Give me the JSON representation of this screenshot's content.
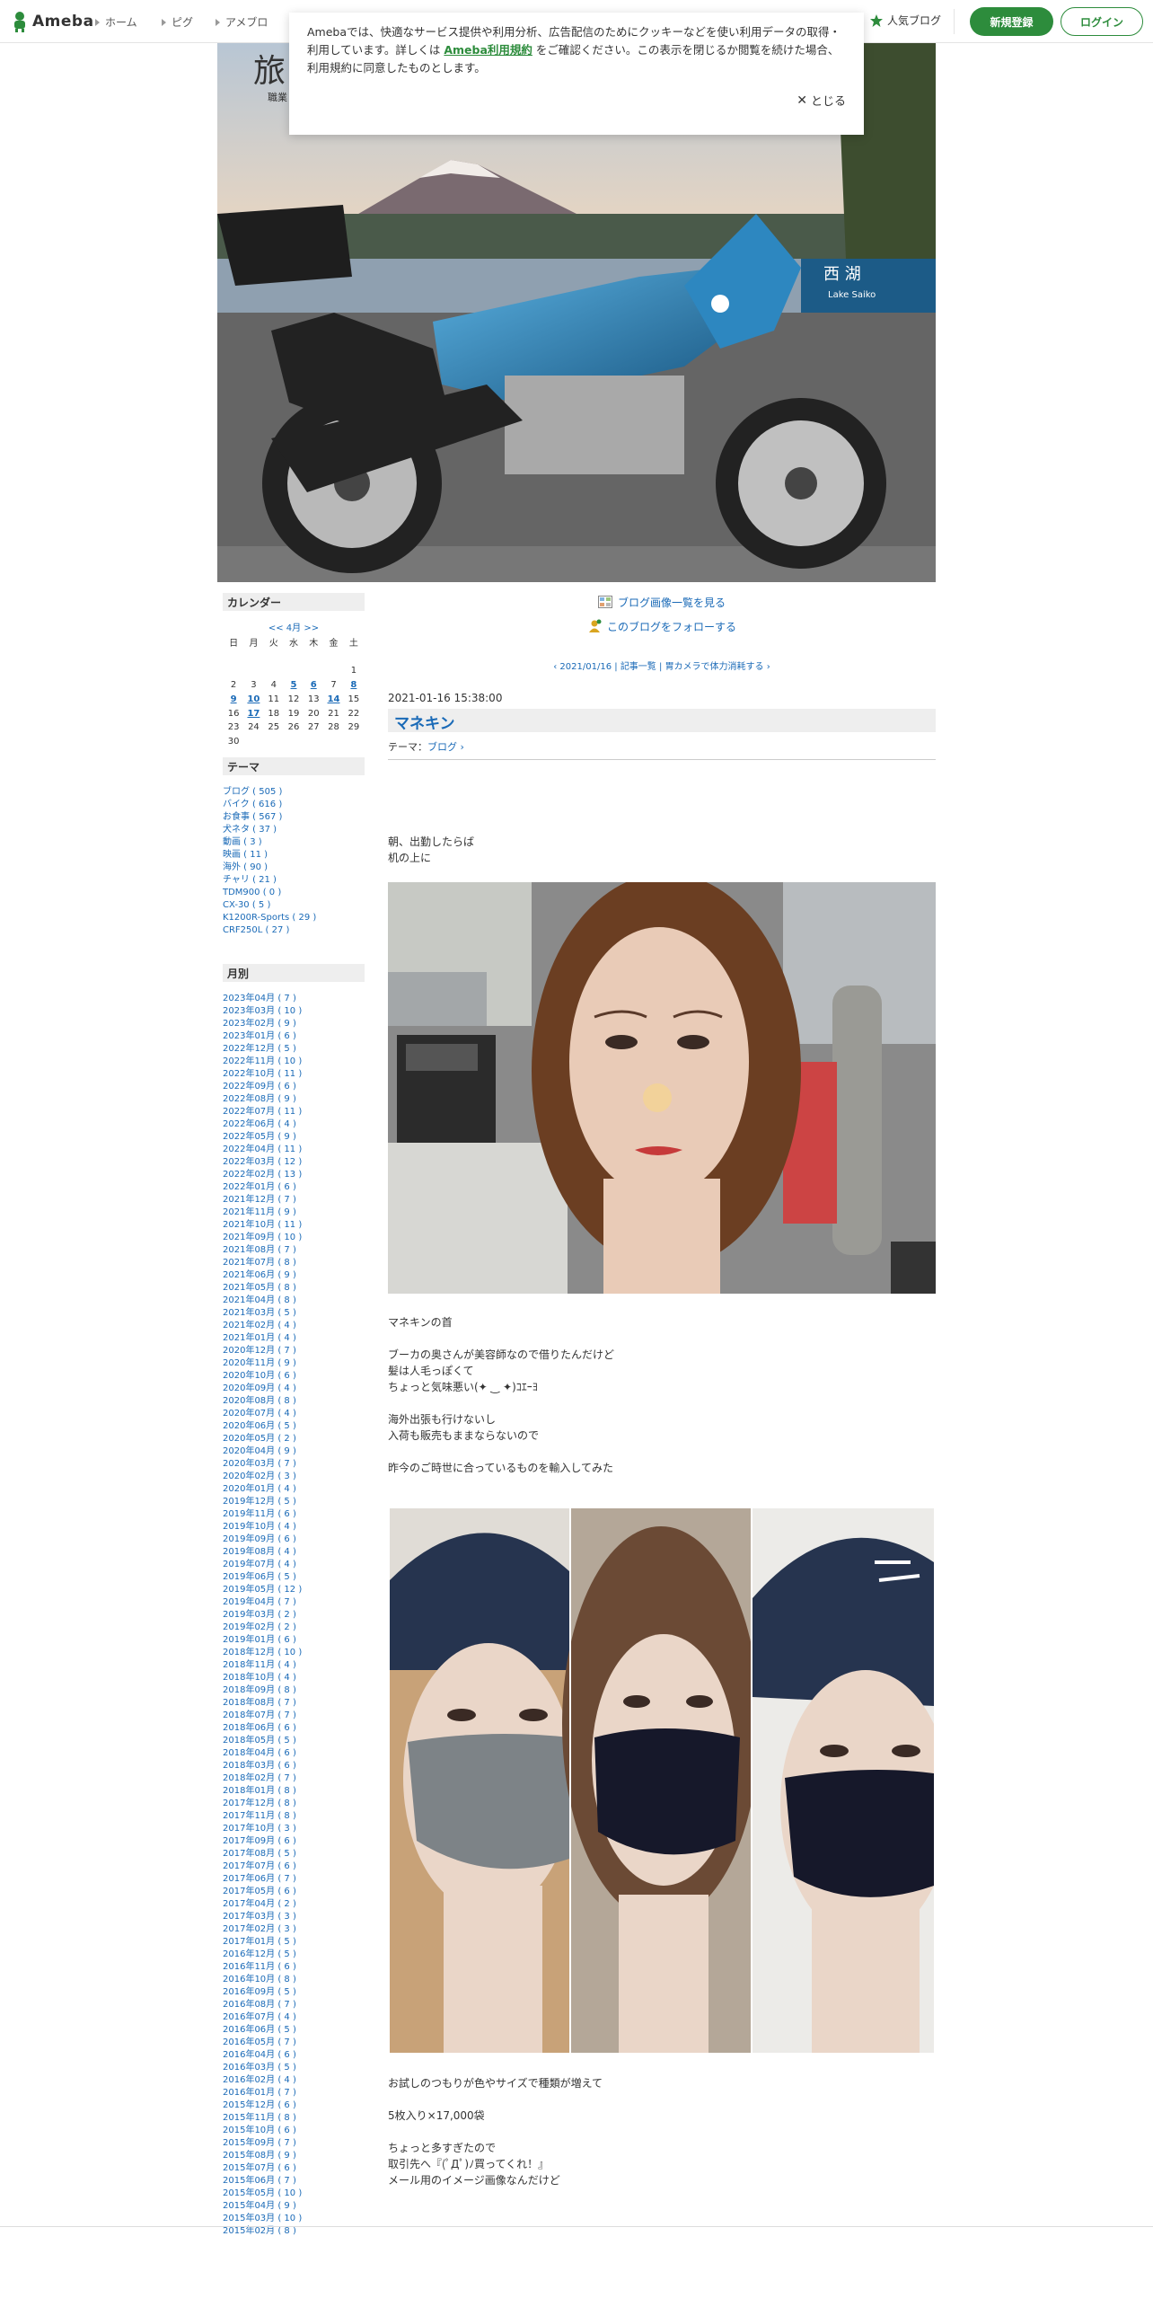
{
  "topbar": {
    "logo_text": "Ameba",
    "nav": [
      "ホーム",
      "ピグ",
      "アメブロ"
    ],
    "popular": "人気ブログ",
    "register": "新規登録",
    "login": "ログイン"
  },
  "cookie": {
    "text_before": "Amebaでは、快適なサービス提供や利用分析、広告配信のためにクッキーなどを使い利用データの取得・利用しています。詳しくは ",
    "link": "Ameba利用規約",
    "text_after": " をご確認ください。この表示を閉じるか閲覧を続けた場合、利用規約に同意したものとします。",
    "close": "とじる"
  },
  "blog": {
    "title": "旅",
    "subtitle": "職業"
  },
  "calendar": {
    "heading": "カレンダー",
    "nav": "<< 4月 >>",
    "weekdays": [
      "日",
      "月",
      "火",
      "水",
      "木",
      "金",
      "土"
    ],
    "weeks": [
      [
        "",
        "",
        "",
        "",
        "",
        "",
        "1"
      ],
      [
        "2",
        "3",
        "4",
        "5",
        "6",
        "7",
        "8"
      ],
      [
        "9",
        "10",
        "11",
        "12",
        "13",
        "14",
        "15"
      ],
      [
        "16",
        "17",
        "18",
        "19",
        "20",
        "21",
        "22"
      ],
      [
        "23",
        "24",
        "25",
        "26",
        "27",
        "28",
        "29"
      ],
      [
        "30",
        "",
        "",
        "",
        "",
        "",
        ""
      ]
    ]
  },
  "theme_box": {
    "heading": "テーマ",
    "items": [
      "ブログ ( 505 )",
      "バイク ( 616 )",
      "お食事 ( 567 )",
      "犬ネタ ( 37 )",
      "動画 ( 3 )",
      "映画 ( 11 )",
      "海外 ( 90 )",
      "チャリ ( 21 )",
      "TDM900 ( 0 )",
      "CX-30 ( 5 )",
      "K1200R-Sports ( 29 )",
      "CRF250L ( 27 )"
    ]
  },
  "monthly": {
    "heading": "月別",
    "items": [
      "2023年04月 ( 7 )",
      "2023年03月 ( 10 )",
      "2023年02月 ( 9 )",
      "2023年01月 ( 6 )",
      "2022年12月 ( 5 )",
      "2022年11月 ( 10 )",
      "2022年10月 ( 11 )",
      "2022年09月 ( 6 )",
      "2022年08月 ( 9 )",
      "2022年07月 ( 11 )",
      "2022年06月 ( 4 )",
      "2022年05月 ( 9 )",
      "2022年04月 ( 11 )",
      "2022年03月 ( 12 )",
      "2022年02月 ( 13 )",
      "2022年01月 ( 6 )",
      "2021年12月 ( 7 )",
      "2021年11月 ( 9 )",
      "2021年10月 ( 11 )",
      "2021年09月 ( 10 )",
      "2021年08月 ( 7 )",
      "2021年07月 ( 8 )",
      "2021年06月 ( 9 )",
      "2021年05月 ( 8 )",
      "2021年04月 ( 8 )",
      "2021年03月 ( 5 )",
      "2021年02月 ( 4 )",
      "2021年01月 ( 4 )",
      "2020年12月 ( 7 )",
      "2020年11月 ( 9 )",
      "2020年10月 ( 6 )",
      "2020年09月 ( 4 )",
      "2020年08月 ( 8 )",
      "2020年07月 ( 4 )",
      "2020年06月 ( 5 )",
      "2020年05月 ( 2 )",
      "2020年04月 ( 9 )",
      "2020年03月 ( 7 )",
      "2020年02月 ( 3 )",
      "2020年01月 ( 4 )",
      "2019年12月 ( 5 )",
      "2019年11月 ( 6 )",
      "2019年10月 ( 4 )",
      "2019年09月 ( 6 )",
      "2019年08月 ( 4 )",
      "2019年07月 ( 4 )",
      "2019年06月 ( 5 )",
      "2019年05月 ( 12 )",
      "2019年04月 ( 7 )",
      "2019年03月 ( 2 )",
      "2019年02月 ( 2 )",
      "2019年01月 ( 6 )",
      "2018年12月 ( 10 )",
      "2018年11月 ( 4 )",
      "2018年10月 ( 4 )",
      "2018年09月 ( 8 )",
      "2018年08月 ( 7 )",
      "2018年07月 ( 7 )",
      "2018年06月 ( 6 )",
      "2018年05月 ( 5 )",
      "2018年04月 ( 6 )",
      "2018年03月 ( 6 )",
      "2018年02月 ( 7 )",
      "2018年01月 ( 8 )",
      "2017年12月 ( 8 )",
      "2017年11月 ( 8 )",
      "2017年10月 ( 3 )",
      "2017年09月 ( 6 )",
      "2017年08月 ( 5 )",
      "2017年07月 ( 6 )",
      "2017年06月 ( 7 )",
      "2017年05月 ( 6 )",
      "2017年04月 ( 2 )",
      "2017年03月 ( 3 )",
      "2017年02月 ( 3 )",
      "2017年01月 ( 5 )",
      "2016年12月 ( 5 )",
      "2016年11月 ( 6 )",
      "2016年10月 ( 8 )",
      "2016年09月 ( 5 )",
      "2016年08月 ( 7 )",
      "2016年07月 ( 4 )",
      "2016年06月 ( 5 )",
      "2016年05月 ( 7 )",
      "2016年04月 ( 6 )",
      "2016年03月 ( 5 )",
      "2016年02月 ( 4 )",
      "2016年01月 ( 7 )",
      "2015年12月 ( 6 )",
      "2015年11月 ( 8 )",
      "2015年10月 ( 6 )",
      "2015年09月 ( 7 )",
      "2015年08月 ( 9 )",
      "2015年07月 ( 6 )",
      "2015年06月 ( 7 )",
      "2015年05月 ( 10 )",
      "2015年04月 ( 9 )",
      "2015年03月 ( 10 )",
      "2015年02月 ( 8 )"
    ]
  },
  "main": {
    "image_list_link": "ブログ画像一覧を見る",
    "follow_link": "このブログをフォローする",
    "pager": {
      "prev": "2021/01/16",
      "list": "記事一覧",
      "next": "胃カメラで体力消耗する"
    },
    "entry": {
      "date": "2021-01-16 15:38:00",
      "title": "マネキン",
      "theme_label": "テーマ：",
      "theme_link": "ブログ",
      "para1": [
        "朝、出勤したらば",
        "机の上に"
      ],
      "para2": [
        "マネキンの首",
        "",
        "ブーカの奥さんが美容師なので借りたんだけど",
        "髪は人毛っぽくて",
        "ちょっと気味悪い(✦ ‿ ︎✦)ｺｴｰﾖ",
        "",
        "海外出張も行けないし",
        "入荷も販売もままならないので",
        "",
        "昨今のご時世に合っているものを輸入してみた"
      ],
      "para3": [
        "お試しのつもりが色やサイズで種類が増えて",
        "",
        "5枚入り×17,000袋",
        "",
        "ちょっと多すぎたので",
        "取引先へ『(ﾟДﾟ)ﾉ買ってくれ！』",
        "メール用のイメージ画像なんだけど"
      ]
    }
  },
  "colors": {
    "brand_green": "#2d8c3c",
    "link_blue": "#1a6ab7",
    "heading_bg": "#eeeeee"
  }
}
